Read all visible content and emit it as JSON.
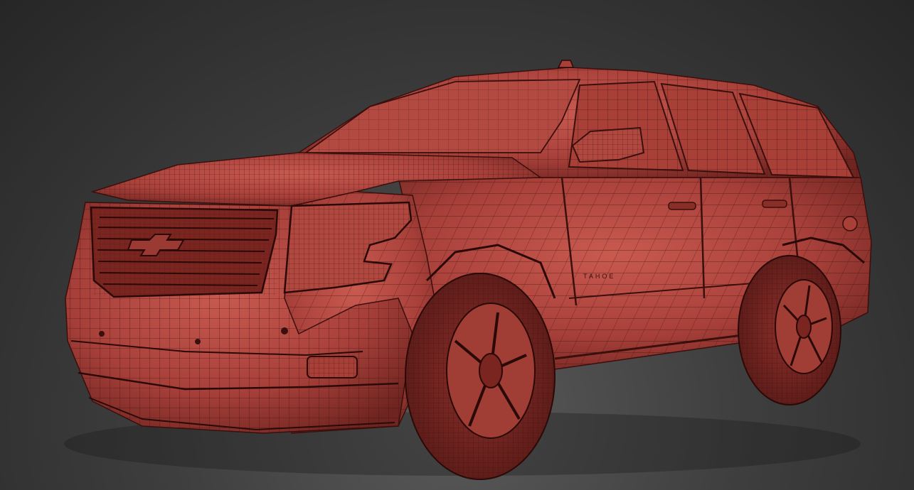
{
  "viewport": {
    "background_top": "#222222",
    "background_bottom": "#5a5a5a",
    "mesh_color": "#b84a42",
    "wire_color": "#3a0f0c"
  },
  "model": {
    "badge_text": "TAHOE"
  }
}
